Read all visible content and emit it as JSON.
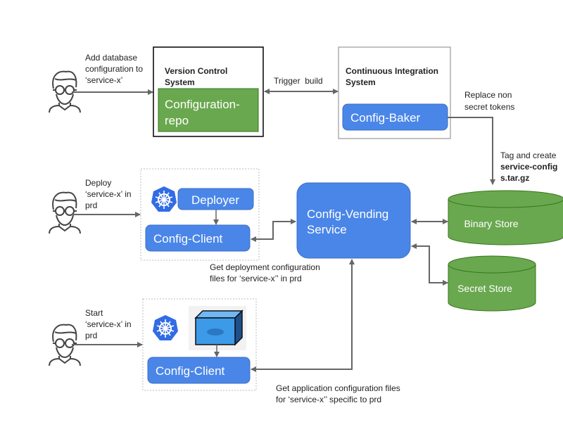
{
  "colors": {
    "blue": "#4a86e8",
    "green": "#6aa84f",
    "arrow": "#666666"
  },
  "actors": [
    {
      "icon": "person-icon",
      "lines": [
        "Add database",
        "configuration to",
        "‘service-x’"
      ]
    },
    {
      "icon": "person-icon",
      "lines": [
        "Deploy",
        "‘service-x’ in",
        "prd"
      ]
    },
    {
      "icon": "person-icon",
      "lines": [
        "Start",
        "‘service-x’ in",
        "prd"
      ]
    }
  ],
  "vcs": {
    "title": [
      "Version Control",
      "System"
    ],
    "repo": [
      "Configuration-",
      "repo"
    ]
  },
  "trigger_label": "Trigger  build",
  "ci": {
    "title": [
      "Continuous Integration",
      "System"
    ],
    "baker": "Config-Baker"
  },
  "replace_label": [
    "Replace non",
    "secret tokens"
  ],
  "tag_label": [
    "Tag and create",
    "service-config",
    "s.tar.gz"
  ],
  "binary_store": "Binary Store",
  "secret_store": "Secret Store",
  "vending": [
    "Config-Vending",
    "Service"
  ],
  "deploy_group": {
    "deployer": "Deployer",
    "client": "Config-Client"
  },
  "deploy_note": [
    "Get deployment configuration",
    "files for ‘service-x’’ in prd"
  ],
  "start_group": {
    "client": "Config-Client"
  },
  "start_note": [
    "Get application configuration files",
    "for ‘service-x’’ specific to prd"
  ]
}
